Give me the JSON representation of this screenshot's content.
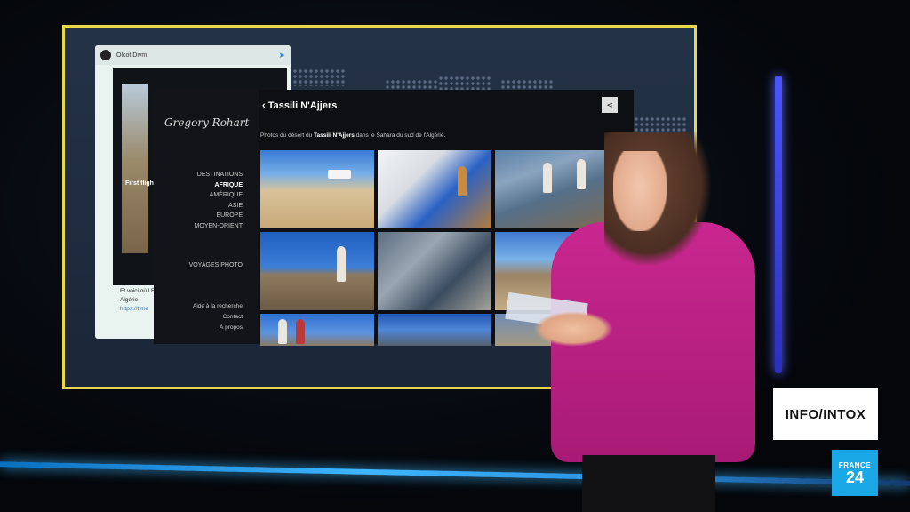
{
  "website": {
    "title": "Tassili N'Ajjers",
    "description_prefix": "Photos du désert du ",
    "description_bold": "Tassili N'Ajjers",
    "description_suffix": " dans le Sahara du sud de l'Algérie.",
    "logo": "Gregory Rohart",
    "nav": [
      {
        "label": "DESTINATIONS",
        "active": false
      },
      {
        "label": "AFRIQUE",
        "active": true
      },
      {
        "label": "AMÉRIQUE",
        "active": false
      },
      {
        "label": "ASIE",
        "active": false
      },
      {
        "label": "EUROPE",
        "active": false
      },
      {
        "label": "MOYEN-ORIENT",
        "active": false
      }
    ],
    "voyages": "VOYAGES PHOTO",
    "footer_links": [
      "Aide à la recherche",
      "Contact",
      "À propos"
    ]
  },
  "tweet": {
    "author": "Olcot Divm",
    "headline": "First fligh",
    "text": "Et voici où l En Algérie",
    "link": "https://t.me"
  },
  "branding": {
    "show": "INFO/INTOX",
    "channel_top": "FRANCE",
    "channel_bottom": "24"
  }
}
